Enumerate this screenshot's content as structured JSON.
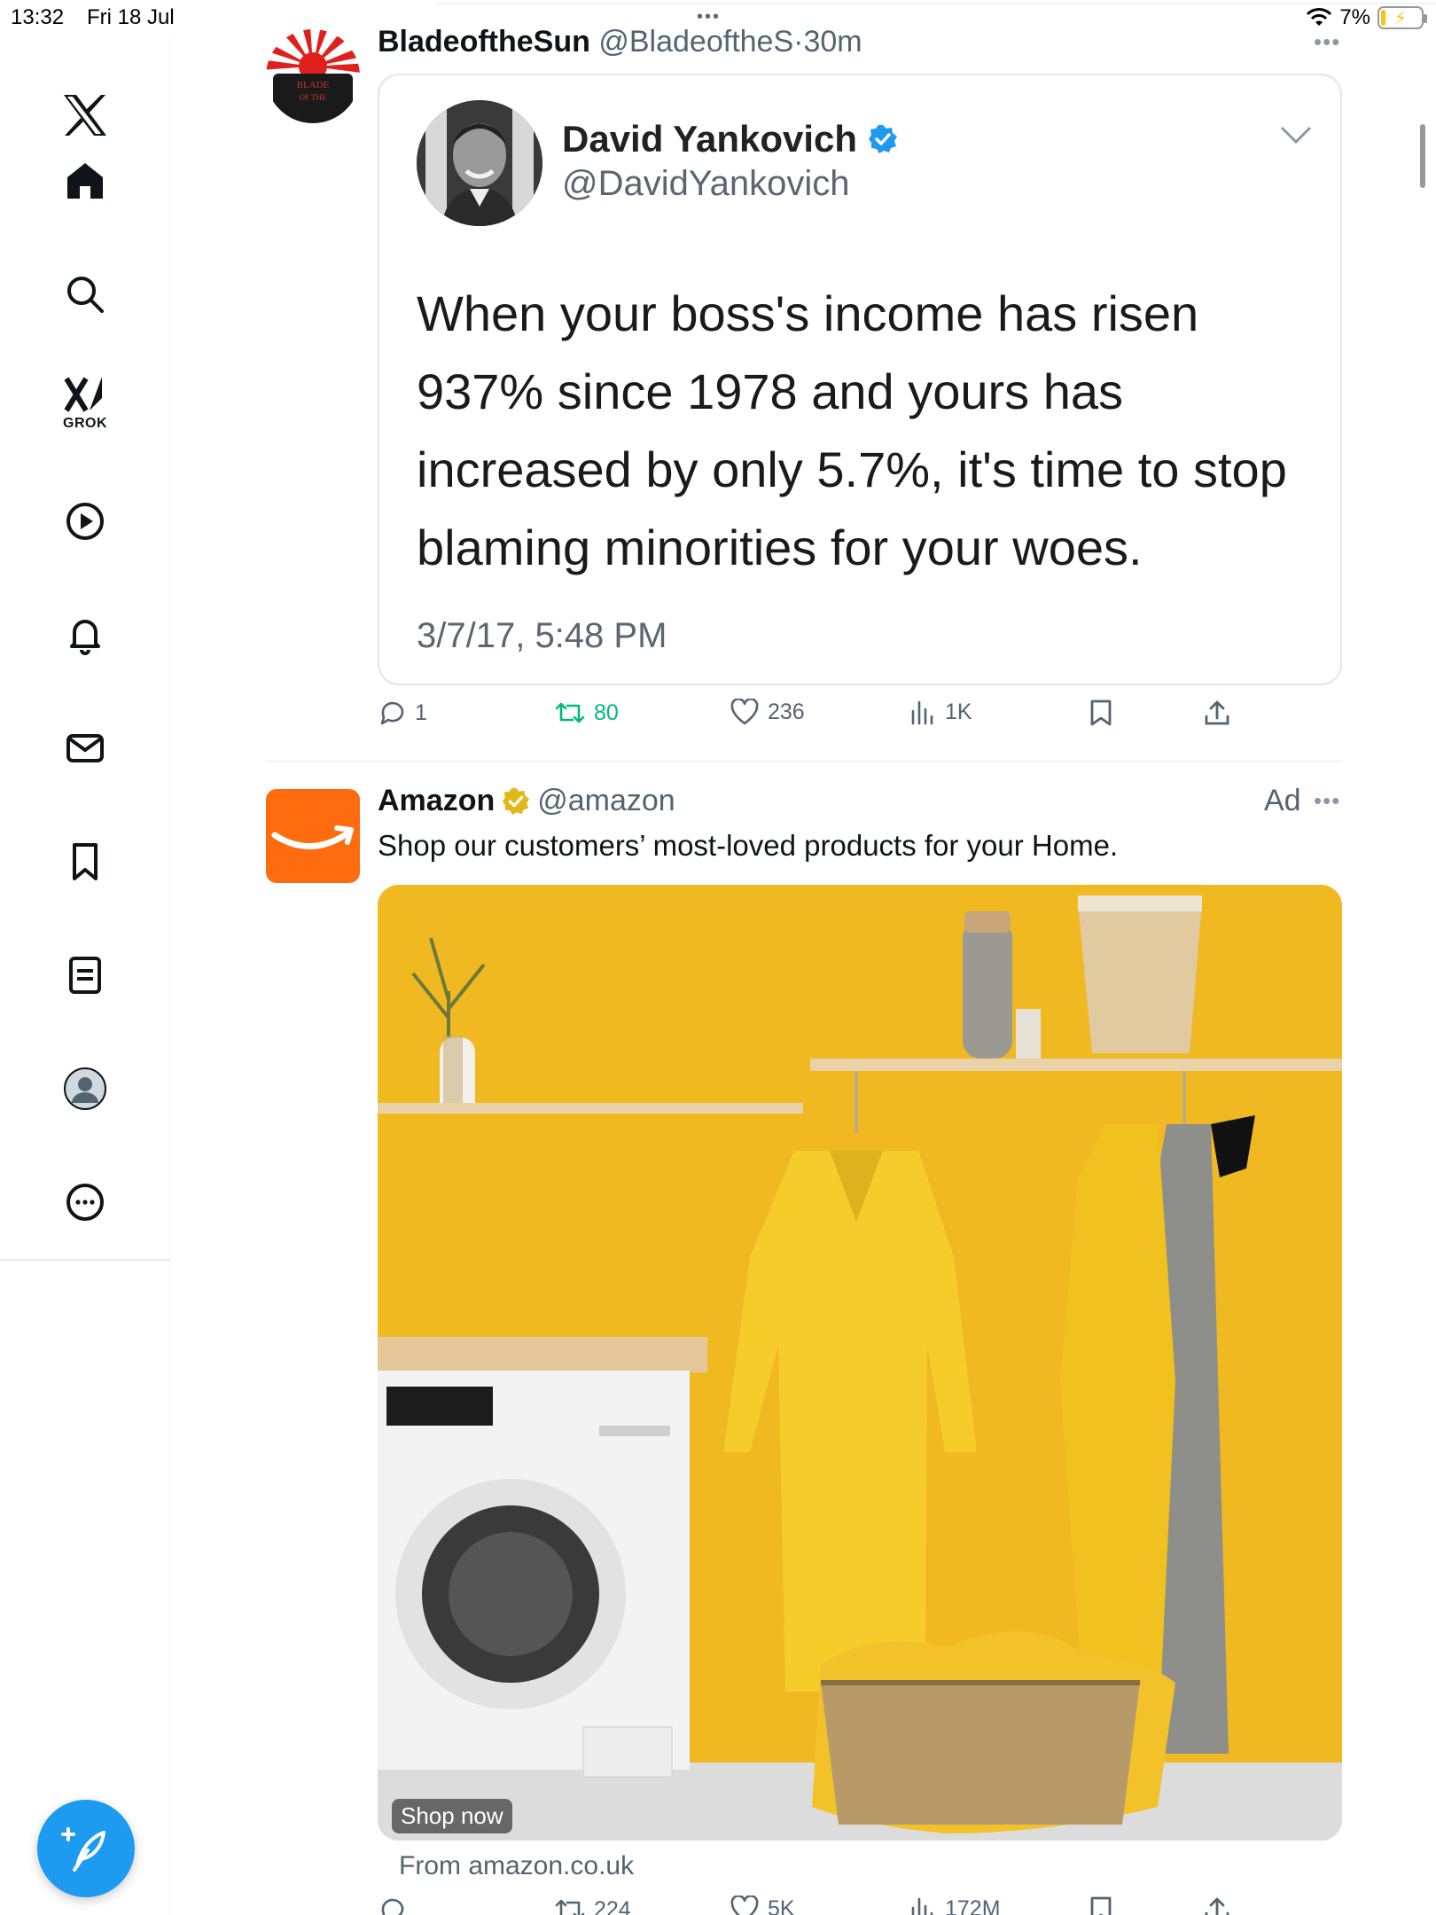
{
  "status_bar": {
    "time": "13:32",
    "date": "Fri 18 Jul",
    "battery": "7%",
    "battery_level": 0.07,
    "multitask_dots": "•••"
  },
  "sidebar": {
    "items": [
      {
        "name": "x-logo",
        "label": ""
      },
      {
        "name": "home",
        "label": ""
      },
      {
        "name": "search",
        "label": ""
      },
      {
        "name": "grok",
        "label": "GROK"
      },
      {
        "name": "videos",
        "label": ""
      },
      {
        "name": "notifications",
        "label": ""
      },
      {
        "name": "messages",
        "label": ""
      },
      {
        "name": "bookmarks",
        "label": ""
      },
      {
        "name": "lists",
        "label": ""
      },
      {
        "name": "profile",
        "label": ""
      },
      {
        "name": "more",
        "label": ""
      }
    ],
    "compose_icon": "compose-icon"
  },
  "post": {
    "display_name": "BladeoftheSun",
    "handle": "@BladeoftheS",
    "separator": "·",
    "time_ago": "30m",
    "avatar_text": "BLADE OF THE",
    "quote": {
      "name": "David Yankovich",
      "handle": "@DavidYankovich",
      "verified": true,
      "text": "When your boss's income has risen 937% since 1978 and yours has increased by only 5.7%, it's time to stop blaming minorities for your woes.",
      "date": "3/7/17, 5:48 PM"
    },
    "actions": {
      "replies": "1",
      "reposts": "80",
      "likes": "236",
      "views": "1K"
    }
  },
  "ad": {
    "display_name": "Amazon",
    "handle": "@amazon",
    "ad_label": "Ad",
    "text": "Shop our customers’ most-loved products for your Home.",
    "cta": "Shop now",
    "from": "From amazon.co.uk",
    "actions": {
      "replies": "",
      "reposts": "224",
      "likes": "5K",
      "views": "172M"
    }
  },
  "colors": {
    "accent": "#1d9bf0",
    "repost_green": "#00ba7c",
    "amazon_orange": "#ff6b0f",
    "ad_wall": "#f0b922"
  }
}
